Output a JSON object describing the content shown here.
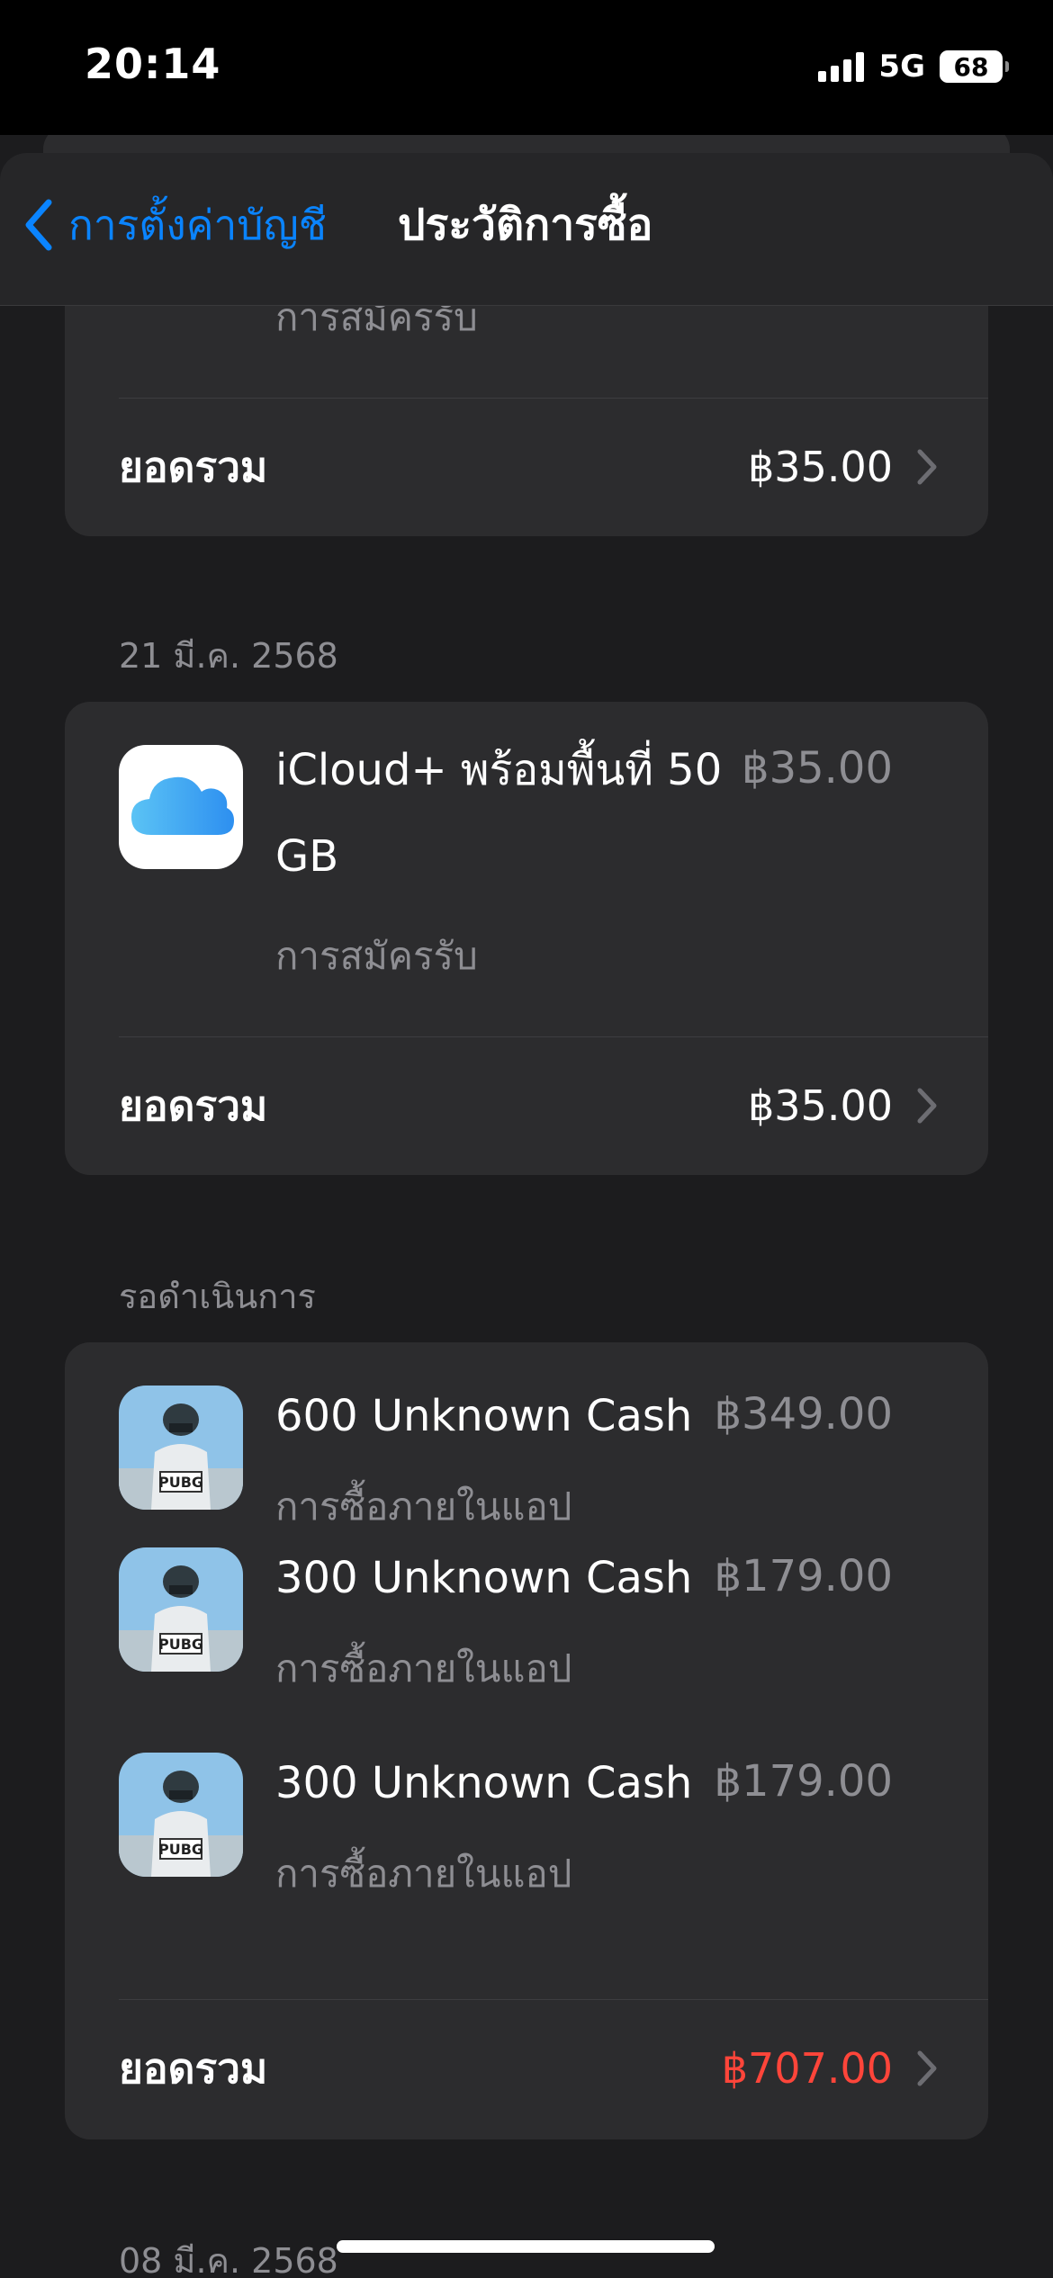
{
  "status_bar": {
    "time": "20:14",
    "network": "5G",
    "battery": "68"
  },
  "nav": {
    "back_label": "การตั้งค่าบัญชี",
    "title": "ประวัติการซื้อ"
  },
  "group_top": {
    "partial_subtitle": "การสมัครรับ",
    "total_label": "ยอดรวม",
    "total_amount": "฿35.00"
  },
  "group_mar21": {
    "date": "21 มี.ค. 2568",
    "item": {
      "title_line1": "iCloud+ พร้อมพื้นที่ 50",
      "title_line2": "GB",
      "subtitle": "การสมัครรับ",
      "price": "฿35.00",
      "icon": "icloud-icon"
    },
    "total_label": "ยอดรวม",
    "total_amount": "฿35.00"
  },
  "group_pending": {
    "header": "รอดำเนินการ",
    "items": [
      {
        "title": "600 Unknown Cash",
        "subtitle": "การซื้อภายในแอป",
        "price": "฿349.00",
        "icon": "pubg-mobile-icon"
      },
      {
        "title": "300 Unknown Cash",
        "subtitle": "การซื้อภายในแอป",
        "price": "฿179.00",
        "icon": "pubg-mobile-icon"
      },
      {
        "title": "300 Unknown Cash",
        "subtitle": "การซื้อภายในแอป",
        "price": "฿179.00",
        "icon": "pubg-mobile-icon"
      }
    ],
    "total_label": "ยอดรวม",
    "total_amount": "฿707.00",
    "total_color": "#ff453a"
  },
  "group_mar08": {
    "date": "08 มี.ค. 2568"
  },
  "colors": {
    "accent": "#0a84ff",
    "background": "#1c1c1e",
    "card": "#2c2c2e",
    "secondary_text": "#8e8e93",
    "pending_total": "#ff453a"
  }
}
